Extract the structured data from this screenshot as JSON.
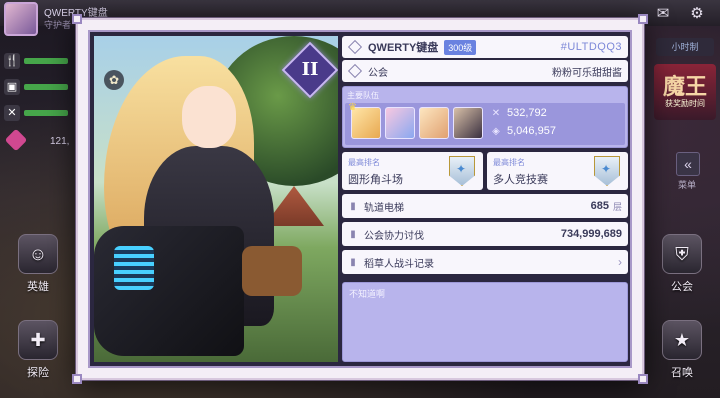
{
  "background": {
    "top_name": "QWERTY键盘",
    "top_sub": "守护者",
    "gem_count": "121,",
    "menu_left": [
      "英雄",
      "探险"
    ],
    "menu_right": [
      "公会",
      "召唤"
    ],
    "right_tag": "小时制",
    "right_banner": "魔王",
    "right_banner_sub": "获奖励时间",
    "collapse_label": "菜单",
    "top_icons": [
      "mail-icon",
      "gear-icon"
    ]
  },
  "profile": {
    "rank_numeral": "II",
    "name": "QWERTY键盘",
    "level": "300级",
    "uid": "#ULTDQQ3",
    "guild_label": "公会",
    "guild_name": "粉粉可乐甜甜酱",
    "team_title": "主要队伍",
    "team_power": "532,792",
    "team_hp": "5,046,957",
    "highest_rank_label_1": "最高排名",
    "highest_rank_value_1": "圆形角斗场",
    "highest_rank_label_2": "最高排名",
    "highest_rank_value_2": "多人竞技赛",
    "orbit_label": "轨道电梯",
    "orbit_value": "685",
    "orbit_unit": "层",
    "guild_raid_label": "公会协力讨伐",
    "guild_raid_value": "734,999,689",
    "scarecrow_label": "稻草人战斗记录",
    "memo_text": "不知道啊"
  },
  "colors": {
    "accent": "#7d88d8",
    "team_bg": "#b8b4ec",
    "level_badge": "#6a82e0"
  }
}
